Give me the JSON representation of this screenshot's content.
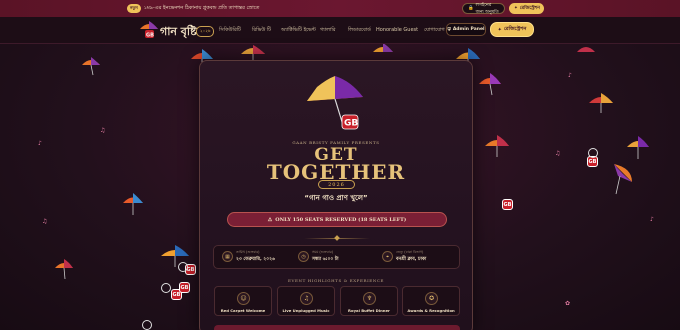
{
  "topbar": {
    "badge": "নতুন",
    "announcement": "১ম৯-এর ইনভেনশন ঠিকানায় প্লুকবন্ড প্রতি তাপান্তর স্রোতে",
    "login_label": "লগইনের জন্য অনুমতি",
    "register_label": "রেজিস্ট্রেশন"
  },
  "nav": {
    "brand": "গান বৃষ্টি",
    "brand_tag": "২০২৬",
    "items": [
      "সিকিউরিটি",
      "রিভিউ টি",
      "অ্যাক্টিভিটি ইভেন্ট",
      "গ্যালারি",
      "লিডারবোর্ড",
      "Honorable Guest",
      "যোগাযোগ"
    ],
    "admin_label": "Admin Panel",
    "register_label": "রেজিস্ট্রেশন"
  },
  "event": {
    "presents": "GAAN BRISTY FAMILY PRESENTS",
    "title_line1": "GET",
    "title_line2": "TOGETHER",
    "year": "2026",
    "tagline": "“গান গাও প্রাণ খুলে”",
    "alert": "ONLY 150 SEATS RESERVED (18 SEATS LEFT)",
    "date_label": "তারিখ (শুক্রবার)",
    "date_value": "২৩ ফেব্রুয়ারি, ২০২৬",
    "time_label": "সময় (শুক্রবার)",
    "time_value": "সন্ধ্যা ৬:০০ টা",
    "venue_label": "ভেন্যু (ঢাকা বিভাগ)",
    "venue_value": "বনশ্রী ক্লাব, ঢাকা",
    "highlights_title": "EVENT HIGHLIGHTS & EXPERIENCE",
    "highlights": [
      "Red Carpet Welcome",
      "Live Unplugged Music",
      "Royal Buffet Dinner",
      "Awards & Recognition"
    ]
  },
  "icons": {
    "date": "calendar-icon",
    "time": "clock-icon",
    "venue": "location-pin-icon",
    "highlights": [
      "red-carpet-icon",
      "music-icon",
      "dinner-icon",
      "award-icon"
    ]
  },
  "colors": {
    "accent": "#f0c35a",
    "primary": "#7a1f35",
    "background": "#22101c"
  }
}
